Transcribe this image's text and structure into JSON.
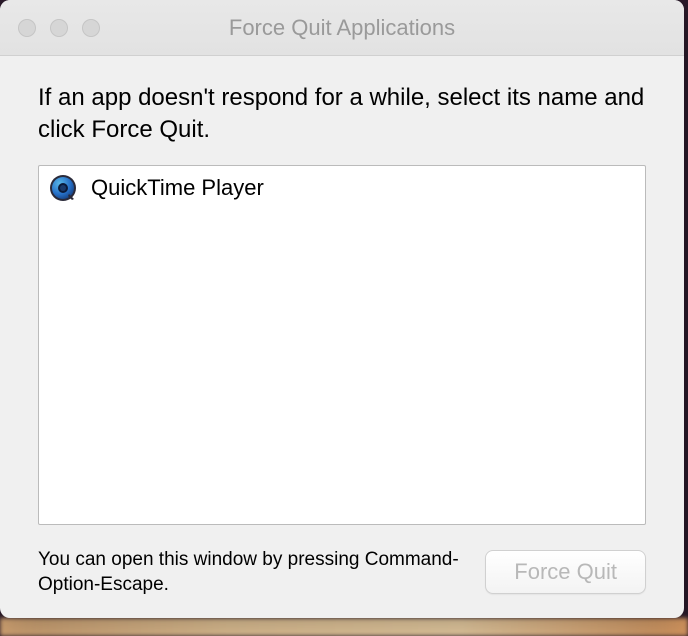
{
  "window": {
    "title": "Force Quit Applications"
  },
  "instruction": "If an app doesn't respond for a while, select its name and click Force Quit.",
  "apps": [
    {
      "name": "QuickTime Player",
      "icon": "quicktime-icon"
    }
  ],
  "hint": "You can open this window by pressing Command-Option-Escape.",
  "buttons": {
    "force_quit": "Force Quit"
  }
}
